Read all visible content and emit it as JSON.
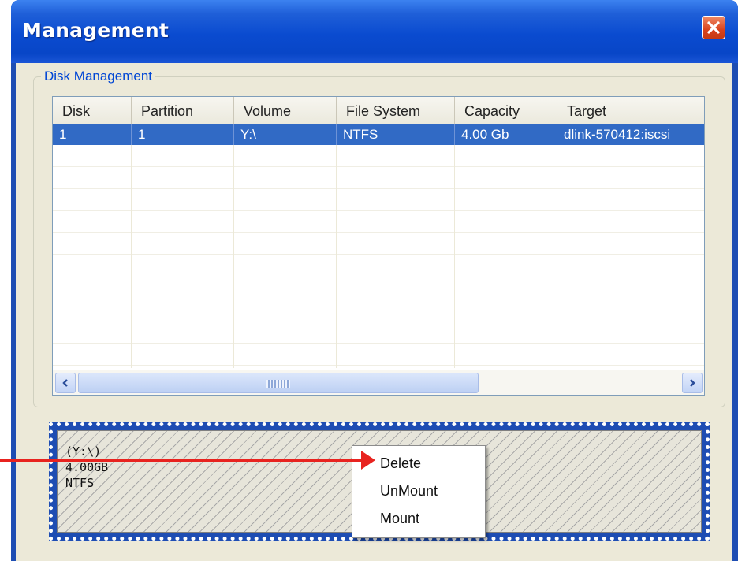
{
  "window": {
    "title": "Management"
  },
  "disk_management": {
    "group_label": "Disk Management",
    "columns": [
      "Disk",
      "Partition",
      "Volume",
      "File System",
      "Capacity",
      "Target"
    ],
    "rows": [
      {
        "disk": "1",
        "partition": "1",
        "volume": "Y:\\",
        "file_system": "NTFS",
        "capacity": "4.00 Gb",
        "target": "dlink-570412:iscsi",
        "selected": true
      }
    ]
  },
  "volume_panel": {
    "drive": "(Y:\\)",
    "size": "4.00GB",
    "file_system": "NTFS"
  },
  "context_menu": {
    "items": [
      "Delete",
      "UnMount",
      "Mount"
    ]
  },
  "colors": {
    "title_bar": "#0a4bd0",
    "selection": "#316ac5",
    "annotation_arrow": "#e8231f",
    "close_button": "#d9421c"
  }
}
